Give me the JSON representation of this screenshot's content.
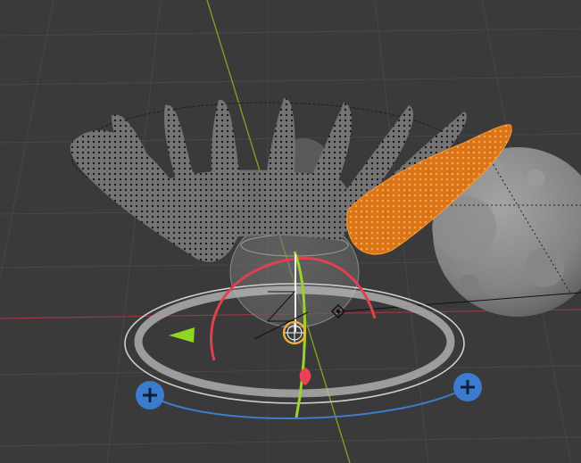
{
  "viewport": {
    "background": "#3a3a3a",
    "grid_color": "#4a4a4a",
    "x_axis_color": "#a23a45",
    "y_axis_color": "#8aa82f"
  },
  "objects": {
    "unselected_mesh_color": "#6b6b6b",
    "vertex_color": "#111111",
    "selected_vertex_color": "#ff8a1e",
    "selected_mesh_color": "#e27515",
    "sphere_color": "#8e8e8e"
  },
  "gizmo": {
    "rotate_ring_color": "#d9d9d9",
    "x_arc_color": "#e0404f",
    "y_arc_color": "#9ad32b",
    "z_arc_color": "#3f7ccc",
    "handle_color": "#3b7ccf",
    "handle_icon": "plus-icon",
    "arrow_x_icon": "triangle-arrow-icon",
    "pivot_icon": "crosshair-circle-icon",
    "empty_icon": "diamond-icon"
  }
}
